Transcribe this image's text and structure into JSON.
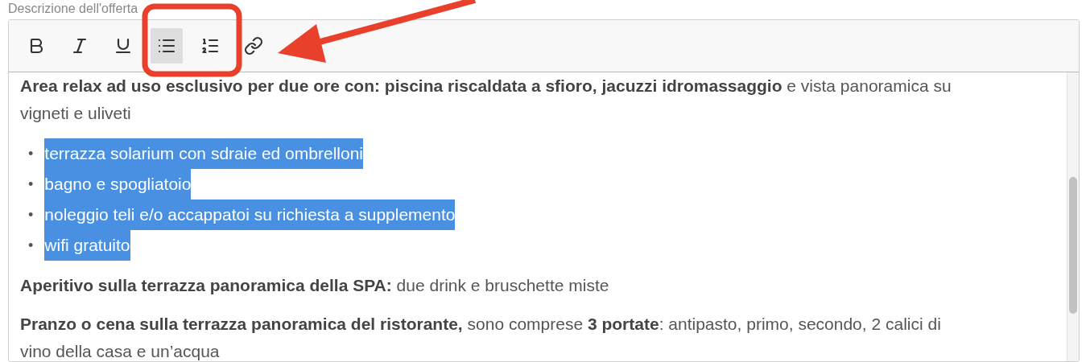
{
  "field_label": "Descrizione dell'offerta",
  "toolbar": [
    {
      "kind": "bold",
      "active": false
    },
    {
      "kind": "italic",
      "active": false
    },
    {
      "kind": "underline",
      "active": false
    },
    {
      "kind": "bullet-list",
      "active": true
    },
    {
      "kind": "numbered-list",
      "active": false
    },
    {
      "kind": "link",
      "active": false
    }
  ],
  "content": [
    {
      "kind": "paragraph",
      "text": "**Area relax ad uso esclusivo per due ore con: piscina riscaldata a sfioro, jacuzzi idromassaggio** e vista panoramica su vigneti e uliveti"
    },
    {
      "kind": "list",
      "items": [
        {
          "marker": "•",
          "text": "terrazza solarium con sdraie ed ombrelloni",
          "highlighted": true
        },
        {
          "marker": "•",
          "text": "bagno e spogliatoio",
          "highlighted": true
        },
        {
          "marker": "•",
          "text": "noleggio teli e/o accappatoi su richiesta a supplemento",
          "highlighted": true
        },
        {
          "marker": "•",
          "text": "wifi gratuito",
          "highlighted": true
        }
      ]
    },
    {
      "kind": "paragraph",
      "text": "**Aperitivo sulla terrazza panoramica della SPA:** due drink e bruschette miste"
    },
    {
      "kind": "paragraph",
      "text": "**Pranzo o cena sulla terrazza panoramica del ristorante,** sono comprese **3 portate**: antipasto, primo, secondo, 2 calici di vino della casa e un’acqua"
    }
  ]
}
